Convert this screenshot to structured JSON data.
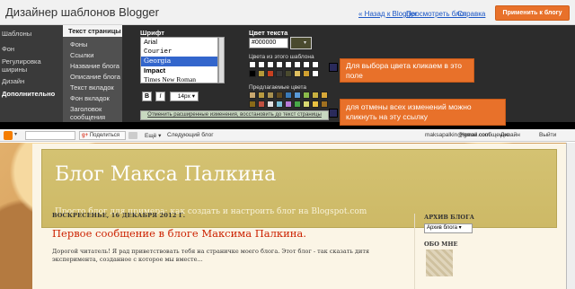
{
  "header": {
    "app_title": "Дизайнер шаблонов Blogger",
    "back_link": "« Назад к Blogger",
    "view_link": "Просмотреть блог",
    "help_link": "Справка",
    "apply_button": "Применить к блогу"
  },
  "left_nav": [
    "Шаблоны",
    "Фон",
    "Регулировка ширины",
    "Дизайн",
    "Дополнительно"
  ],
  "sub_nav": [
    "Текст страницы",
    "Фоны",
    "Ссылки",
    "Название блога",
    "Описание блога",
    "Текст вкладок",
    "Фон вкладок",
    "Заголовок сообщения"
  ],
  "font_panel": {
    "heading": "Шрифт",
    "fonts": [
      "Arial",
      "Courier",
      "Georgia",
      "Impact",
      "Times New Roman"
    ],
    "selected": "Georgia",
    "bold": "B",
    "italic": "I",
    "size": "14px"
  },
  "color_panel": {
    "heading": "Цвет текста",
    "value": "#000000",
    "template_label": "Цвета из этого шаблона",
    "suggested_label": "Предлагаемые цвета",
    "template_colors": [
      "#ffffff",
      "#ffffff",
      "#ffffff",
      "#ffffff",
      "#ffffff",
      "#ffffff",
      "#ffffff",
      "#ffffff",
      "#000000",
      "#b59a3a",
      "#c84020",
      "#3a3a3a",
      "#4a4a2e",
      "#e0c060",
      "#d0a030",
      "#ffffff"
    ],
    "suggested_colors": [
      "#c8a870",
      "#b89a40",
      "#a89050",
      "#604a20",
      "#3a7ab8",
      "#5a9ad8",
      "#8aba4a",
      "#c8b040",
      "#d8a838",
      "#8a6a18",
      "#c05040",
      "#e0e0e0",
      "#7ac0d8",
      "#b87ad8",
      "#48a848",
      "#d8d870",
      "#e8c040",
      "#a07020"
    ]
  },
  "annotations": {
    "color_hint": "Для выбора цвета кликаем в это поле",
    "reset_hint": "для отмены всех изменений можно кликнуть на эту ссылку",
    "reset_link": "Отменить расширенные изменения, восстановить до текст страницы"
  },
  "blogger_nav": {
    "share": "Поделиться",
    "more": "Ещё",
    "next_blog": "Следующий блог",
    "user": "maksapalkin@gmail.com",
    "new_post": "Новое сообщение",
    "design": "Дизайн",
    "logout": "Выйти"
  },
  "blog": {
    "title": "Блог Макса Палкина",
    "description": "Просто блог для примера: как создать и настроить блог на Blogspot.com",
    "date": "ВОСКРЕСЕНЬЕ, 16 ДЕКАБРЯ 2012 Г.",
    "post_title": "Первое сообщение в блоге Максима Палкина.",
    "post_body": "Дорогой читатель! Я рад приветствовать тебя на страничке моего блога. Этот блог - так сказать дитя эксперимента, созданное с которое мы вместе...",
    "archive_heading": "АРХИВ БЛОГА",
    "archive_select": "Архив блога",
    "about_heading": "ОБО МНЕ"
  }
}
